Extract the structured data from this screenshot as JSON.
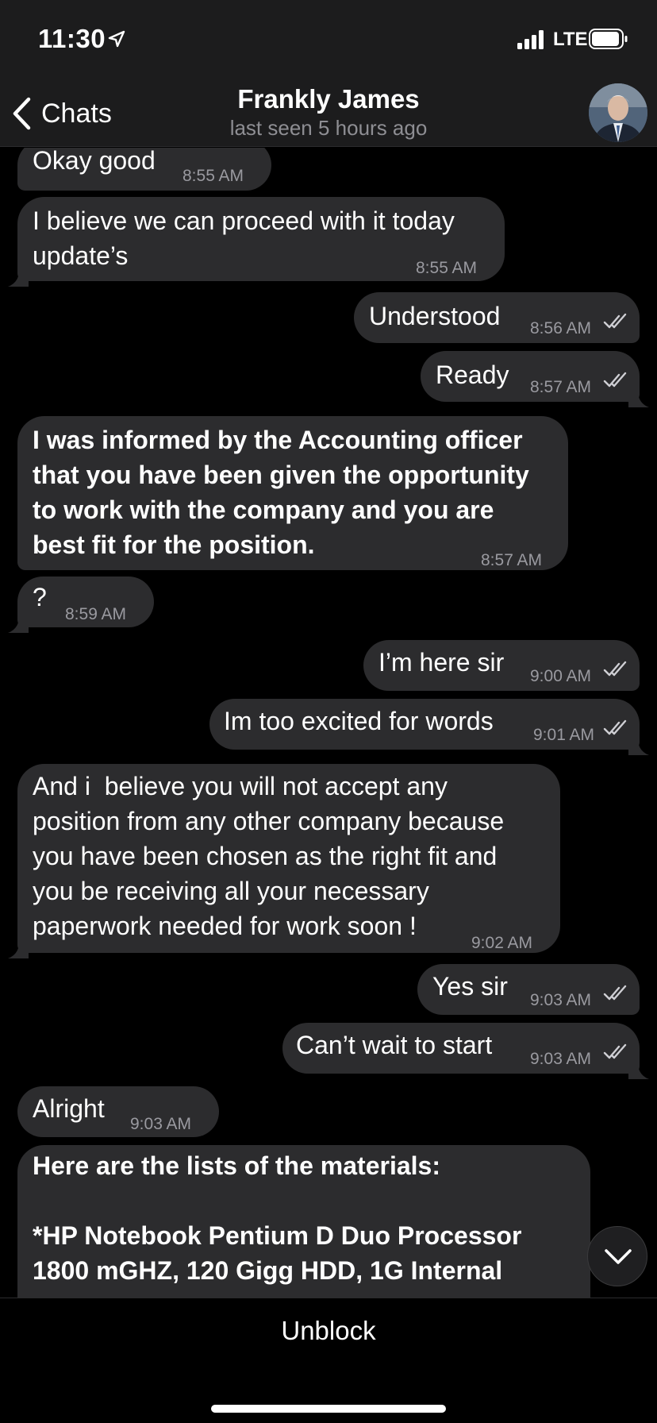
{
  "status_bar": {
    "time": "11:30",
    "network": "LTE"
  },
  "header": {
    "back_label": "Chats",
    "contact_name": "Frankly James",
    "contact_status": "last seen 5 hours ago"
  },
  "messages": [
    {
      "dir": "in",
      "text": "Okay good",
      "time": "8:55 AM",
      "bold": false
    },
    {
      "dir": "in",
      "text": "I believe we can proceed with it today\nupdate’s",
      "time": "8:55 AM",
      "bold": false
    },
    {
      "dir": "out",
      "text": "Understood",
      "time": "8:56 AM",
      "read": true
    },
    {
      "dir": "out",
      "text": "Ready",
      "time": "8:57 AM",
      "read": true
    },
    {
      "dir": "in",
      "text": "I was informed by the Accounting officer\nthat you have been given the opportunity\nto work with the company and you are\nbest fit for the position.",
      "time": "8:57 AM",
      "bold": true
    },
    {
      "dir": "in",
      "text": "?",
      "time": "8:59 AM",
      "bold": false
    },
    {
      "dir": "out",
      "text": "I’m here sir",
      "time": "9:00 AM",
      "read": true
    },
    {
      "dir": "out",
      "text": "Im too excited for words",
      "time": "9:01 AM",
      "read": true
    },
    {
      "dir": "in",
      "text": "And i  believe you will not accept any\nposition from any other company because\nyou have been chosen as the right fit and\nyou be receiving all your necessary\npaperwork needed for work soon !",
      "time": "9:02 AM",
      "bold": false
    },
    {
      "dir": "out",
      "text": "Yes sir",
      "time": "9:03 AM",
      "read": true
    },
    {
      "dir": "out",
      "text": "Can’t wait to start",
      "time": "9:03 AM",
      "read": true
    },
    {
      "dir": "in",
      "text": "Alright",
      "time": "9:03 AM",
      "bold": false
    },
    {
      "dir": "in",
      "text": "Here are the lists of the materials:\n\n*HP Notebook Pentium D Duo Processor\n1800 mGHZ, 120 Gigg HDD, 1G Internal",
      "time": "",
      "bold": true
    }
  ],
  "footer": {
    "unblock_label": "Unblock"
  },
  "colors": {
    "bubble": "#2c2c2e",
    "background": "#000000",
    "header": "#1c1c1d",
    "timestamp": "#9a9aa0"
  }
}
